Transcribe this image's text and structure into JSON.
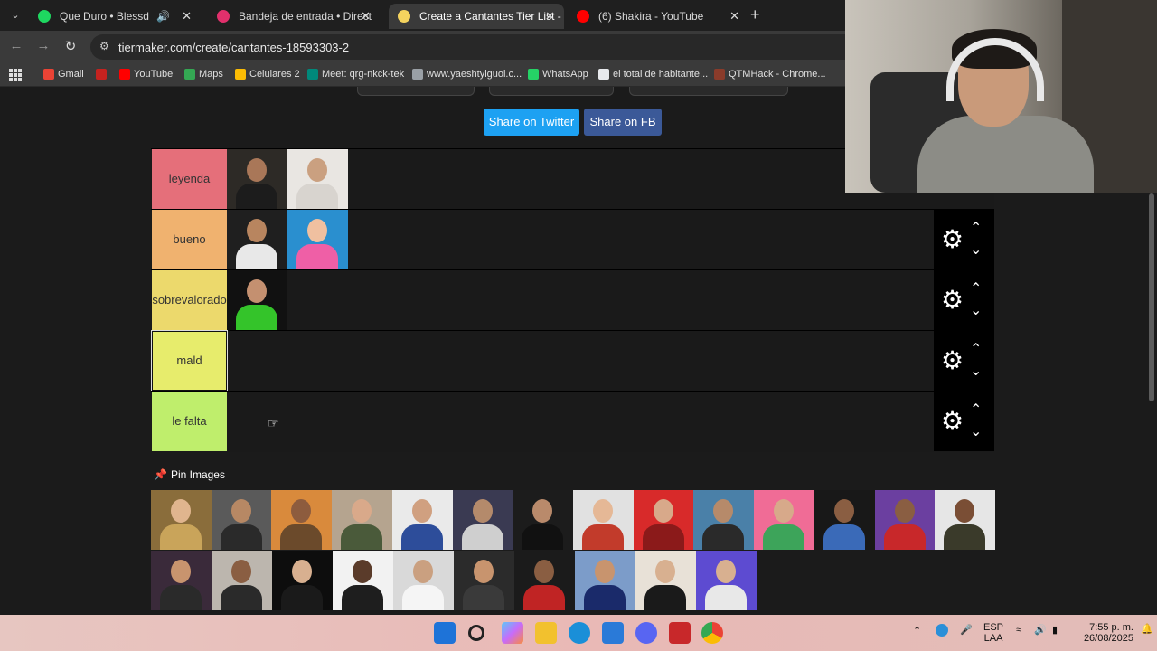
{
  "browser": {
    "tabs": [
      {
        "title": "Que Duro • Blessd",
        "favicon_color": "#1ed760",
        "active": false
      },
      {
        "title": "Bandeja de entrada • Direct",
        "favicon_color": "#e1306c",
        "active": false
      },
      {
        "title": "Create a Cantantes Tier List - Ti",
        "favicon_color": "#f4d35e",
        "active": true
      },
      {
        "title": "(6) Shakira - YouTube",
        "favicon_color": "#ff0000",
        "active": false
      }
    ],
    "url": "tiermaker.com/create/cantantes-18593303-2",
    "bookmarks": [
      {
        "label": "Gmail",
        "color": "#ea4335"
      },
      {
        "label": "",
        "color": "#c5221f"
      },
      {
        "label": "YouTube",
        "color": "#ff0000"
      },
      {
        "label": "Maps",
        "color": "#34a853"
      },
      {
        "label": "Celulares 2",
        "color": "#fbbc04"
      },
      {
        "label": "Meet: qrg-nkck-tek",
        "color": "#00897b"
      },
      {
        "label": "www.yaeshtylguoi.c...",
        "color": "#9aa0a6"
      },
      {
        "label": "WhatsApp",
        "color": "#25d366"
      },
      {
        "label": "el total de habitante...",
        "color": "#e8eaed"
      },
      {
        "label": "QTMHack - Chrome...",
        "color": "#8a3b2a"
      }
    ]
  },
  "share": {
    "twitter_label": "Share on Twitter",
    "fb_label": "Share on FB"
  },
  "tiers": [
    {
      "label": "leyenda",
      "color": "#e56f7a",
      "items": [
        {
          "bg": "#2d2a26",
          "skin": "#a97758",
          "cloth": "#1c1c1c"
        },
        {
          "bg": "#e9e6e2",
          "skin": "#caa080",
          "cloth": "#d8d4cf"
        }
      ]
    },
    {
      "label": "bueno",
      "color": "#f0b26f",
      "items": [
        {
          "bg": "#1f1f1f",
          "skin": "#b8855f",
          "cloth": "#e8e8e8"
        },
        {
          "bg": "#2a8fcf",
          "skin": "#f0c0a0",
          "cloth": "#ef5fa6"
        }
      ]
    },
    {
      "label": "sobrevalorado",
      "color": "#ecd96c",
      "items": [
        {
          "bg": "#111111",
          "skin": "#c49070",
          "cloth": "#34c42a"
        }
      ]
    },
    {
      "label": "mald",
      "color": "#e7ec6c",
      "items": [],
      "editing": true
    },
    {
      "label": "le falta",
      "color": "#bfee6c",
      "items": []
    }
  ],
  "icons": {
    "gear": "gear-icon",
    "up": "chevron-up-icon",
    "down": "chevron-down-icon",
    "pin": "pin-icon"
  },
  "pin_images": {
    "title": "Pin Images"
  },
  "pool": [
    [
      {
        "bg": "#8a6d3b",
        "skin": "#e0b58e",
        "cloth": "#c9a45a"
      },
      {
        "bg": "#5a5a5a",
        "skin": "#b78864",
        "cloth": "#2a2a2a"
      },
      {
        "bg": "#d98a3c",
        "skin": "#8d5c3e",
        "cloth": "#6b4a2b"
      },
      {
        "bg": "#b5a48f",
        "skin": "#d9a98a",
        "cloth": "#4a5a3a"
      },
      {
        "bg": "#eaeaea",
        "skin": "#d0a080",
        "cloth": "#2d4d9a"
      },
      {
        "bg": "#3a3a52",
        "skin": "#b48a6b",
        "cloth": "#cfcfcf"
      },
      {
        "bg": "#1c1c1c",
        "skin": "#b98a6b",
        "cloth": "#111111"
      },
      {
        "bg": "#e1e1e1",
        "skin": "#e5b896",
        "cloth": "#c23b2b"
      },
      {
        "bg": "#d82a2a",
        "skin": "#d8a98a",
        "cloth": "#8b1a1a"
      },
      {
        "bg": "#4a80a8",
        "skin": "#b68a6a",
        "cloth": "#2a2a2a"
      },
      {
        "bg": "#f06c96",
        "skin": "#d7a98a",
        "cloth": "#3da45a"
      },
      {
        "bg": "#181818",
        "skin": "#8a5e42",
        "cloth": "#3a6ab8"
      },
      {
        "bg": "#6b3fa0",
        "skin": "#8a5e42",
        "cloth": "#c8282a"
      },
      {
        "bg": "#e6e6e6",
        "skin": "#7a4e35",
        "cloth": "#3a3a2a"
      }
    ],
    [
      {
        "bg": "#3a2a3a",
        "skin": "#c8946e",
        "cloth": "#2a2a2a"
      },
      {
        "bg": "#bcb6ae",
        "skin": "#8a5e42",
        "cloth": "#2a2a2a"
      },
      {
        "bg": "#0d0d0d",
        "skin": "#d8b090",
        "cloth": "#1a1a1a"
      },
      {
        "bg": "#f2f2f2",
        "skin": "#5a3b2a",
        "cloth": "#1e1e1e"
      },
      {
        "bg": "#d9d9d9",
        "skin": "#caa080",
        "cloth": "#f5f5f5"
      },
      {
        "bg": "#2b2b2b",
        "skin": "#c8946e",
        "cloth": "#3a3a3a"
      },
      {
        "bg": "#1b1b1b",
        "skin": "#8a5e42",
        "cloth": "#c02424"
      },
      {
        "bg": "#7c9cc9",
        "skin": "#c8946e",
        "cloth": "#1a2a6a"
      },
      {
        "bg": "#e8e1d7",
        "skin": "#d8b090",
        "cloth": "#1a1a1a"
      },
      {
        "bg": "#5d4bd1",
        "skin": "#d8b090",
        "cloth": "#e8e8e8"
      }
    ]
  ],
  "taskbar": {
    "lang": "ESP",
    "lang2": "LAA",
    "time": "7:55 p. m.",
    "date": "26/08/2025"
  }
}
